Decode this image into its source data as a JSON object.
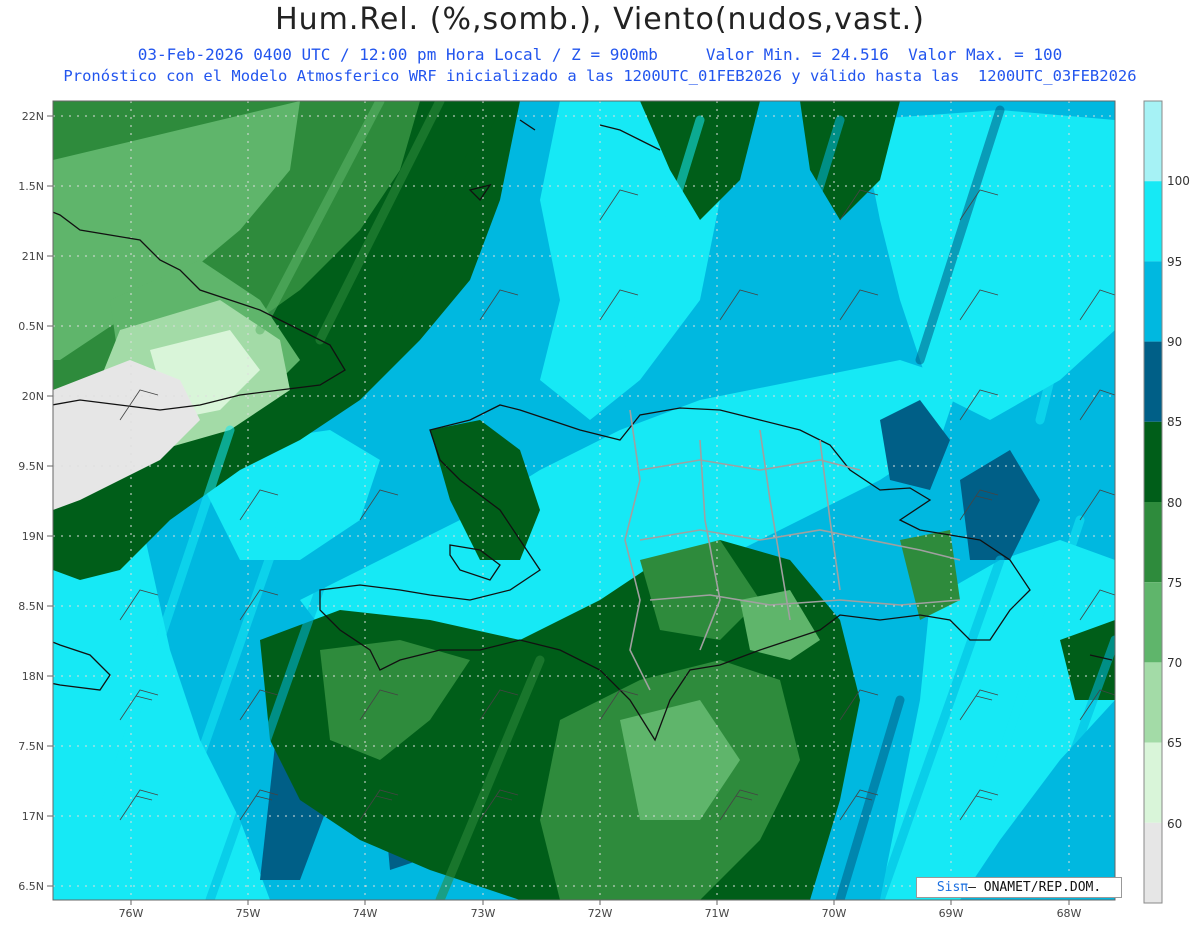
{
  "header": {
    "title": "Hum.Rel. (%,somb.), Viento(nudos,vast.)",
    "datetime": "03-Feb-2026 0400 UTC / 12:00 pm Hora Local / Z = 900mb",
    "min_label": "Valor Min. = 24.516",
    "max_label": "Valor Max. = 100",
    "model_line": "Pronóstico con el Modelo Atmosferico WRF inicializado a las 1200UTC_01FEB2026 y válido hasta las  1200UTC_03FEB2026"
  },
  "axes": {
    "lat_labels": [
      "22N",
      "1.5N",
      "21N",
      "0.5N",
      "20N",
      "9.5N",
      "19N",
      "8.5N",
      "18N",
      "7.5N",
      "17N",
      "6.5N"
    ],
    "lon_labels": [
      "76W",
      "75W",
      "74W",
      "73W",
      "72W",
      "71W",
      "70W",
      "69W",
      "68W"
    ]
  },
  "colorbar": {
    "labels": [
      "100",
      "95",
      "90",
      "85",
      "80",
      "75",
      "70",
      "65",
      "60"
    ],
    "colors": [
      "#a6f2f5",
      "#16e9f5",
      "#00b8e0",
      "#005f87",
      "#005e19",
      "#2e8b3c",
      "#5fb56b",
      "#a3dba7",
      "#d9f5d9",
      "#e6e6e6"
    ]
  },
  "credit": {
    "brand": "Sisπ",
    "org": "– ONAMET/REP.DOM."
  }
}
